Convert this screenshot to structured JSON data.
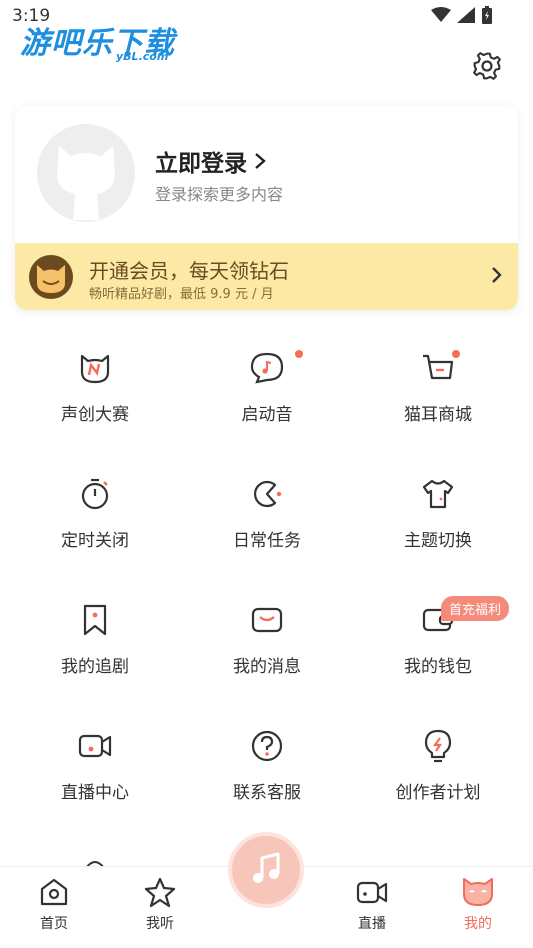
{
  "status_bar": {
    "time": "3:19"
  },
  "watermark": {
    "main": "游吧乐下载",
    "sub": "yBL.com"
  },
  "profile": {
    "login_title": "立即登录",
    "login_subtitle": "登录探索更多内容"
  },
  "vip": {
    "title": "开通会员，每天领钻石",
    "subtitle": "畅听精品好剧，最低 9.9 元 / 月"
  },
  "grid": [
    {
      "label": "声创大赛",
      "icon": "cat-n-icon"
    },
    {
      "label": "启动音",
      "icon": "chat-music-icon",
      "dot": true
    },
    {
      "label": "猫耳商城",
      "icon": "cart-icon",
      "dot": true
    },
    {
      "label": "定时关闭",
      "icon": "timer-icon"
    },
    {
      "label": "日常任务",
      "icon": "task-icon"
    },
    {
      "label": "主题切换",
      "icon": "tshirt-icon"
    },
    {
      "label": "我的追剧",
      "icon": "bookmark-icon"
    },
    {
      "label": "我的消息",
      "icon": "mail-icon"
    },
    {
      "label": "我的钱包",
      "icon": "wallet-icon",
      "badge": "首充福利"
    },
    {
      "label": "直播中心",
      "icon": "live-camera-icon"
    },
    {
      "label": "联系客服",
      "icon": "help-icon"
    },
    {
      "label": "创作者计划",
      "icon": "bulb-icon"
    }
  ],
  "tabs": [
    {
      "label": "首页",
      "icon": "home-icon"
    },
    {
      "label": "我听",
      "icon": "star-icon"
    },
    {
      "label": "直播",
      "icon": "video-icon"
    },
    {
      "label": "我的",
      "icon": "cat-face-icon",
      "active": true
    }
  ],
  "colors": {
    "accent": "#f36d5a",
    "vip_bg": "#fde9a6",
    "vip_text": "#6b4a1f"
  }
}
